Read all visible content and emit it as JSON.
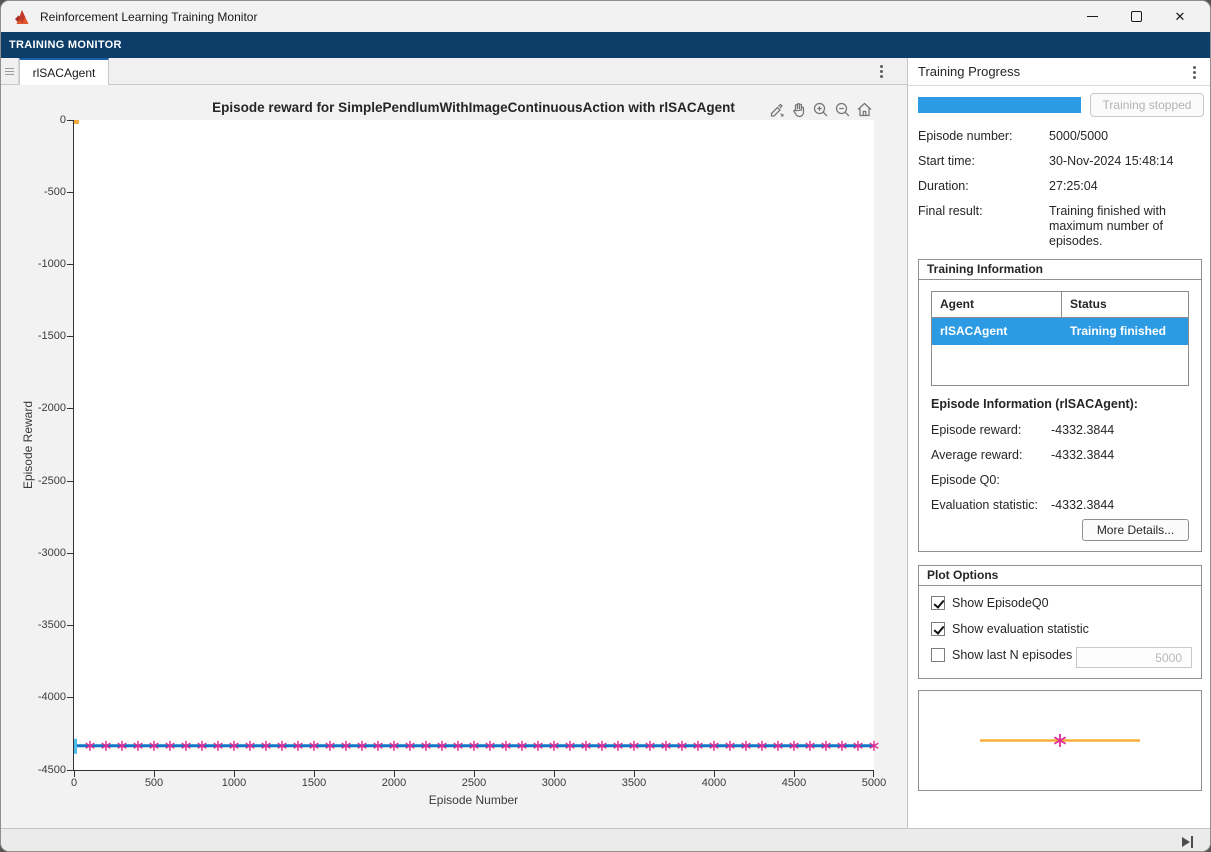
{
  "window": {
    "title": "Reinforcement Learning Training Monitor",
    "controls": [
      "minimize",
      "maximize",
      "close"
    ]
  },
  "ribbon": {
    "label": "TRAINING MONITOR"
  },
  "tabs": {
    "active": "rlSACAgent"
  },
  "axes_toolbar_icons": [
    "brush",
    "pan",
    "zoom-in",
    "zoom-out",
    "home"
  ],
  "progress_panel": {
    "title": "Training Progress",
    "progress_percent": 100,
    "progress_color": "#2D9BE4",
    "stop_button": "Training stopped",
    "fields": [
      {
        "label": "Episode number:",
        "value": "5000/5000"
      },
      {
        "label": "Start time:",
        "value": "30-Nov-2024 15:48:14"
      },
      {
        "label": "Duration:",
        "value": "27:25:04"
      },
      {
        "label": "Final result:",
        "value": "Training finished with maximum number of episodes."
      }
    ]
  },
  "training_information": {
    "title": "Training Information",
    "table": {
      "headers": [
        "Agent",
        "Status"
      ],
      "rows": [
        {
          "agent": "rlSACAgent",
          "status": "Training finished",
          "selected": true
        }
      ],
      "selection_color": "#2D9BE4"
    },
    "episode_info_title": "Episode Information (rlSACAgent):",
    "fields": [
      {
        "label": "Episode reward:",
        "value": "-4332.3844"
      },
      {
        "label": "Average reward:",
        "value": "-4332.3844"
      },
      {
        "label": "Episode Q0:",
        "value": ""
      },
      {
        "label": "Evaluation statistic:",
        "value": "-4332.3844"
      }
    ],
    "more_details_button": "More Details..."
  },
  "plot_options": {
    "title": "Plot Options",
    "checkboxes": [
      {
        "label": "Show EpisodeQ0",
        "checked": true
      },
      {
        "label": "Show evaluation statistic",
        "checked": true
      },
      {
        "label": "Show last N episodes",
        "checked": false
      }
    ],
    "last_n_value": "5000"
  },
  "chart_data": {
    "type": "line",
    "title": "Episode reward for SimplePendlumWithImageContinuousAction with rlSACAgent",
    "xlabel": "Episode Number",
    "ylabel": "Episode Reward",
    "xlim": [
      0,
      5000
    ],
    "ylim": [
      -4500,
      0
    ],
    "xticks": [
      0,
      500,
      1000,
      1500,
      2000,
      2500,
      3000,
      3500,
      4000,
      4500,
      5000
    ],
    "yticks": [
      0,
      -500,
      -1000,
      -1500,
      -2000,
      -2500,
      -3000,
      -3500,
      -4000,
      -4500
    ],
    "grid": false,
    "legend_position": "none",
    "series": [
      {
        "name": "Episode reward",
        "type": "hline",
        "color": "#0F74C8",
        "y": -4332.3844,
        "x_start": 0,
        "x_end": 5000
      },
      {
        "name": "Episode reward start tick",
        "type": "vtick",
        "color": "#4DBEEE",
        "x": 0,
        "y": -4332.3844
      },
      {
        "name": "EpisodeQ0 start point",
        "type": "corner-point",
        "color": "#F5A93B",
        "x": 0,
        "y": 0
      },
      {
        "name": "Evaluation statistic",
        "type": "asterisk-markers",
        "color": "#DE2D95",
        "x_start": 100,
        "x_step": 100,
        "x_end": 5000,
        "y": -4332.3844
      }
    ],
    "legend_preview": {
      "line_color": "#FBAD3C",
      "marker_color": "#DE2D95"
    }
  },
  "statusbar": {
    "icon": "skip-to-end"
  }
}
